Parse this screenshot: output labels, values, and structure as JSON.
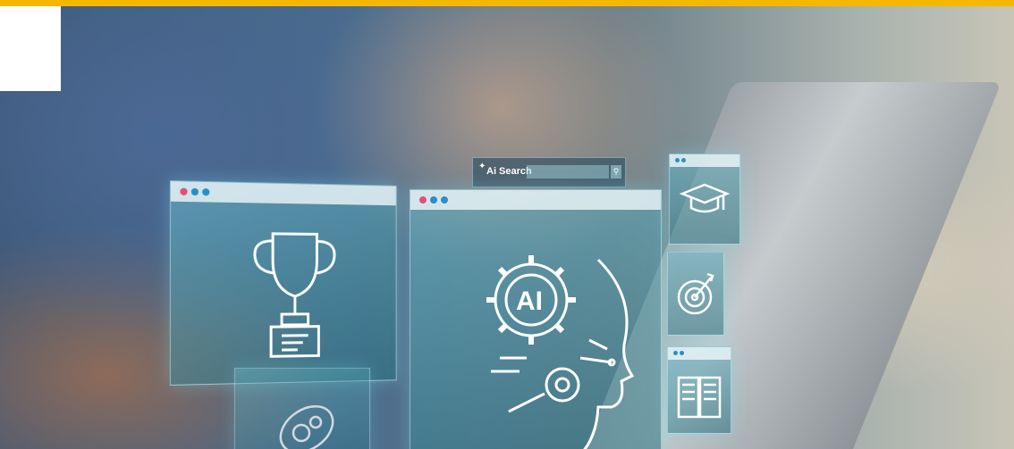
{
  "search_widget": {
    "label": "Ai Search",
    "sparkle_icon": "sparkle-icon",
    "button_icon": "pin-icon"
  },
  "panels": {
    "trophy": {
      "icon": "trophy-icon"
    },
    "ai_head": {
      "icon": "ai-head-gear-icon",
      "text": "AI"
    },
    "graduation": {
      "icon": "graduation-cap-icon"
    },
    "target": {
      "icon": "target-icon"
    },
    "book": {
      "icon": "open-book-icon"
    },
    "gears": {
      "icon": "gears-icon"
    }
  },
  "colors": {
    "top_bar": "#f5b800",
    "dot_red": "#e0507a",
    "dot_blue": "#2a8fc9",
    "icon_stroke": "#ffffff"
  }
}
